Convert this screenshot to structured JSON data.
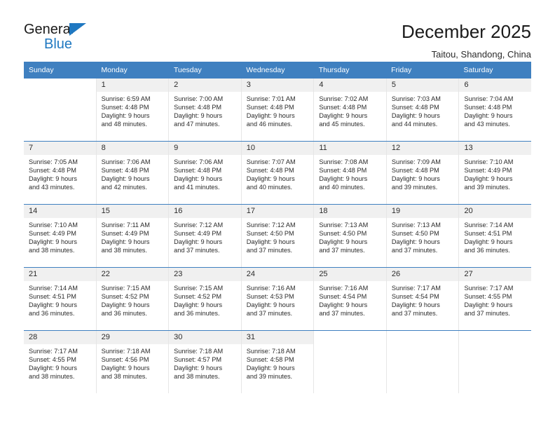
{
  "brand": {
    "name_top": "General",
    "name_bottom": "Blue",
    "triangle_color": "#1f78c1"
  },
  "header": {
    "title": "December 2025",
    "location": "Taitou, Shandong, China"
  },
  "calendar": {
    "header_color": "#3f80c0",
    "weekdays": [
      "Sunday",
      "Monday",
      "Tuesday",
      "Wednesday",
      "Thursday",
      "Friday",
      "Saturday"
    ],
    "weeks": [
      [
        {
          "day": "",
          "lines": []
        },
        {
          "day": "1",
          "lines": [
            "Sunrise: 6:59 AM",
            "Sunset: 4:48 PM",
            "Daylight: 9 hours",
            "and 48 minutes."
          ]
        },
        {
          "day": "2",
          "lines": [
            "Sunrise: 7:00 AM",
            "Sunset: 4:48 PM",
            "Daylight: 9 hours",
            "and 47 minutes."
          ]
        },
        {
          "day": "3",
          "lines": [
            "Sunrise: 7:01 AM",
            "Sunset: 4:48 PM",
            "Daylight: 9 hours",
            "and 46 minutes."
          ]
        },
        {
          "day": "4",
          "lines": [
            "Sunrise: 7:02 AM",
            "Sunset: 4:48 PM",
            "Daylight: 9 hours",
            "and 45 minutes."
          ]
        },
        {
          "day": "5",
          "lines": [
            "Sunrise: 7:03 AM",
            "Sunset: 4:48 PM",
            "Daylight: 9 hours",
            "and 44 minutes."
          ]
        },
        {
          "day": "6",
          "lines": [
            "Sunrise: 7:04 AM",
            "Sunset: 4:48 PM",
            "Daylight: 9 hours",
            "and 43 minutes."
          ]
        }
      ],
      [
        {
          "day": "7",
          "lines": [
            "Sunrise: 7:05 AM",
            "Sunset: 4:48 PM",
            "Daylight: 9 hours",
            "and 43 minutes."
          ]
        },
        {
          "day": "8",
          "lines": [
            "Sunrise: 7:06 AM",
            "Sunset: 4:48 PM",
            "Daylight: 9 hours",
            "and 42 minutes."
          ]
        },
        {
          "day": "9",
          "lines": [
            "Sunrise: 7:06 AM",
            "Sunset: 4:48 PM",
            "Daylight: 9 hours",
            "and 41 minutes."
          ]
        },
        {
          "day": "10",
          "lines": [
            "Sunrise: 7:07 AM",
            "Sunset: 4:48 PM",
            "Daylight: 9 hours",
            "and 40 minutes."
          ]
        },
        {
          "day": "11",
          "lines": [
            "Sunrise: 7:08 AM",
            "Sunset: 4:48 PM",
            "Daylight: 9 hours",
            "and 40 minutes."
          ]
        },
        {
          "day": "12",
          "lines": [
            "Sunrise: 7:09 AM",
            "Sunset: 4:48 PM",
            "Daylight: 9 hours",
            "and 39 minutes."
          ]
        },
        {
          "day": "13",
          "lines": [
            "Sunrise: 7:10 AM",
            "Sunset: 4:49 PM",
            "Daylight: 9 hours",
            "and 39 minutes."
          ]
        }
      ],
      [
        {
          "day": "14",
          "lines": [
            "Sunrise: 7:10 AM",
            "Sunset: 4:49 PM",
            "Daylight: 9 hours",
            "and 38 minutes."
          ]
        },
        {
          "day": "15",
          "lines": [
            "Sunrise: 7:11 AM",
            "Sunset: 4:49 PM",
            "Daylight: 9 hours",
            "and 38 minutes."
          ]
        },
        {
          "day": "16",
          "lines": [
            "Sunrise: 7:12 AM",
            "Sunset: 4:49 PM",
            "Daylight: 9 hours",
            "and 37 minutes."
          ]
        },
        {
          "day": "17",
          "lines": [
            "Sunrise: 7:12 AM",
            "Sunset: 4:50 PM",
            "Daylight: 9 hours",
            "and 37 minutes."
          ]
        },
        {
          "day": "18",
          "lines": [
            "Sunrise: 7:13 AM",
            "Sunset: 4:50 PM",
            "Daylight: 9 hours",
            "and 37 minutes."
          ]
        },
        {
          "day": "19",
          "lines": [
            "Sunrise: 7:13 AM",
            "Sunset: 4:50 PM",
            "Daylight: 9 hours",
            "and 37 minutes."
          ]
        },
        {
          "day": "20",
          "lines": [
            "Sunrise: 7:14 AM",
            "Sunset: 4:51 PM",
            "Daylight: 9 hours",
            "and 36 minutes."
          ]
        }
      ],
      [
        {
          "day": "21",
          "lines": [
            "Sunrise: 7:14 AM",
            "Sunset: 4:51 PM",
            "Daylight: 9 hours",
            "and 36 minutes."
          ]
        },
        {
          "day": "22",
          "lines": [
            "Sunrise: 7:15 AM",
            "Sunset: 4:52 PM",
            "Daylight: 9 hours",
            "and 36 minutes."
          ]
        },
        {
          "day": "23",
          "lines": [
            "Sunrise: 7:15 AM",
            "Sunset: 4:52 PM",
            "Daylight: 9 hours",
            "and 36 minutes."
          ]
        },
        {
          "day": "24",
          "lines": [
            "Sunrise: 7:16 AM",
            "Sunset: 4:53 PM",
            "Daylight: 9 hours",
            "and 37 minutes."
          ]
        },
        {
          "day": "25",
          "lines": [
            "Sunrise: 7:16 AM",
            "Sunset: 4:54 PM",
            "Daylight: 9 hours",
            "and 37 minutes."
          ]
        },
        {
          "day": "26",
          "lines": [
            "Sunrise: 7:17 AM",
            "Sunset: 4:54 PM",
            "Daylight: 9 hours",
            "and 37 minutes."
          ]
        },
        {
          "day": "27",
          "lines": [
            "Sunrise: 7:17 AM",
            "Sunset: 4:55 PM",
            "Daylight: 9 hours",
            "and 37 minutes."
          ]
        }
      ],
      [
        {
          "day": "28",
          "lines": [
            "Sunrise: 7:17 AM",
            "Sunset: 4:55 PM",
            "Daylight: 9 hours",
            "and 38 minutes."
          ]
        },
        {
          "day": "29",
          "lines": [
            "Sunrise: 7:18 AM",
            "Sunset: 4:56 PM",
            "Daylight: 9 hours",
            "and 38 minutes."
          ]
        },
        {
          "day": "30",
          "lines": [
            "Sunrise: 7:18 AM",
            "Sunset: 4:57 PM",
            "Daylight: 9 hours",
            "and 38 minutes."
          ]
        },
        {
          "day": "31",
          "lines": [
            "Sunrise: 7:18 AM",
            "Sunset: 4:58 PM",
            "Daylight: 9 hours",
            "and 39 minutes."
          ]
        },
        {
          "day": "",
          "lines": []
        },
        {
          "day": "",
          "lines": []
        },
        {
          "day": "",
          "lines": []
        }
      ]
    ]
  }
}
